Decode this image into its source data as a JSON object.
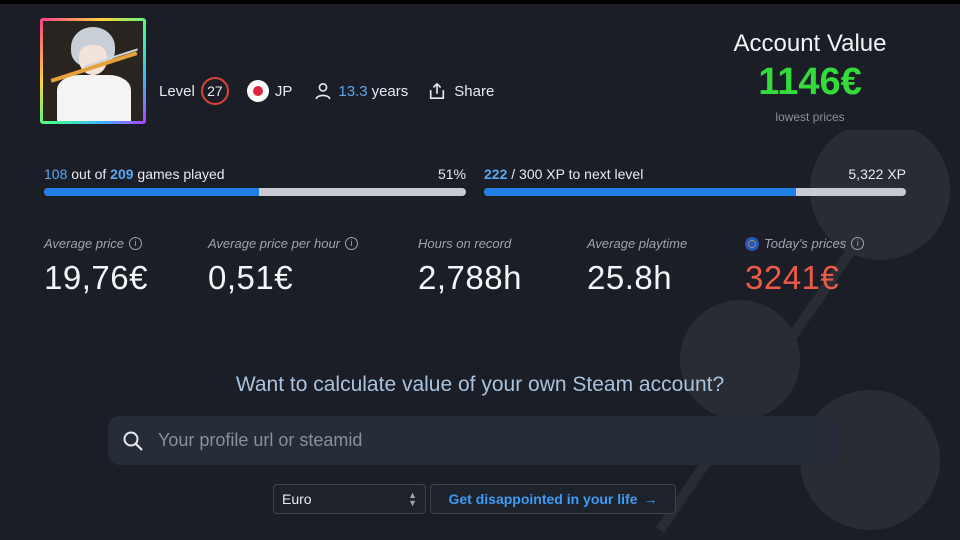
{
  "profile": {
    "level_label": "Level",
    "level": "27",
    "country": "JP",
    "years_num": "13.3",
    "years_label": "years",
    "share_label": "Share"
  },
  "account": {
    "title": "Account Value",
    "value": "1146€",
    "note": "lowest prices"
  },
  "games_progress": {
    "played": "108",
    "out_of_text": "out of",
    "total": "209",
    "suffix": "games played",
    "percent_label": "51%",
    "fraction": 0.51
  },
  "xp_progress": {
    "current": "222",
    "rest": "/ 300 XP to next level",
    "total_label": "5,322 XP",
    "fraction": 0.74
  },
  "stats": [
    {
      "label": "Average price",
      "value": "19,76€",
      "info": true
    },
    {
      "label": "Average price per hour",
      "value": "0,51€",
      "info": true
    },
    {
      "label": "Hours on record",
      "value": "2,788h",
      "info": false
    },
    {
      "label": "Average playtime",
      "value": "25.8h",
      "info": false
    },
    {
      "label": "Today's prices",
      "value": "3241€",
      "info": true
    }
  ],
  "calculate": {
    "prompt": "Want to calculate value of your own Steam account?",
    "placeholder": "Your profile url or steamid",
    "currency": "Euro",
    "button": "Get disappointed in your life",
    "arrow": "→"
  },
  "colors": {
    "accent_blue": "#1f7fe6",
    "value_green": "#33dc3b",
    "today_red": "#ef5a48"
  },
  "icons": [
    "user-icon",
    "share-icon",
    "info-icon",
    "search-icon",
    "eu-flag-icon",
    "jp-flag-icon"
  ]
}
